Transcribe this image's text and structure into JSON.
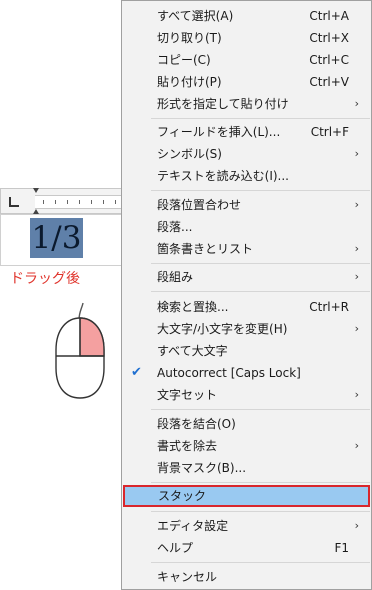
{
  "illustration": {
    "selected_text": "1/3",
    "drag_label": "ドラッグ後",
    "colors": {
      "selection": "#5f80a9",
      "drag_label": "#e0332b",
      "mouse_right_button": "#f4a0a0"
    }
  },
  "menu": {
    "items": [
      {
        "label": "すべて選択(A)",
        "shortcut": "Ctrl+A"
      },
      {
        "label": "切り取り(T)",
        "shortcut": "Ctrl+X"
      },
      {
        "label": "コピー(C)",
        "shortcut": "Ctrl+C"
      },
      {
        "label": "貼り付け(P)",
        "shortcut": "Ctrl+V"
      },
      {
        "label": "形式を指定して貼り付け",
        "submenu": true
      },
      {
        "label": "フィールドを挿入(L)...",
        "shortcut": "Ctrl+F"
      },
      {
        "label": "シンボル(S)",
        "submenu": true
      },
      {
        "label": "テキストを読み込む(I)..."
      },
      {
        "label": "段落位置合わせ",
        "submenu": true
      },
      {
        "label": "段落..."
      },
      {
        "label": "箇条書きとリスト",
        "submenu": true
      },
      {
        "label": "段組み",
        "submenu": true
      },
      {
        "label": "検索と置換...",
        "shortcut": "Ctrl+R"
      },
      {
        "label": "大文字/小文字を変更(H)",
        "submenu": true
      },
      {
        "label": "すべて大文字"
      },
      {
        "label": "Autocorrect [Caps Lock]",
        "checked": true
      },
      {
        "label": "文字セット",
        "submenu": true
      },
      {
        "label": "段落を結合(O)"
      },
      {
        "label": "書式を除去",
        "submenu": true
      },
      {
        "label": "背景マスク(B)..."
      },
      {
        "label": "スタック",
        "highlighted": true
      },
      {
        "label": "エディタ設定",
        "submenu": true
      },
      {
        "label": "ヘルプ",
        "shortcut": "F1"
      },
      {
        "label": "キャンセル"
      }
    ],
    "submenu_glyph": "›",
    "check_glyph": "✔",
    "colors": {
      "background": "#f2f2f2",
      "highlight": "#99c9f1",
      "highlight_border": "#d9262c",
      "check": "#1f6fd0"
    }
  }
}
